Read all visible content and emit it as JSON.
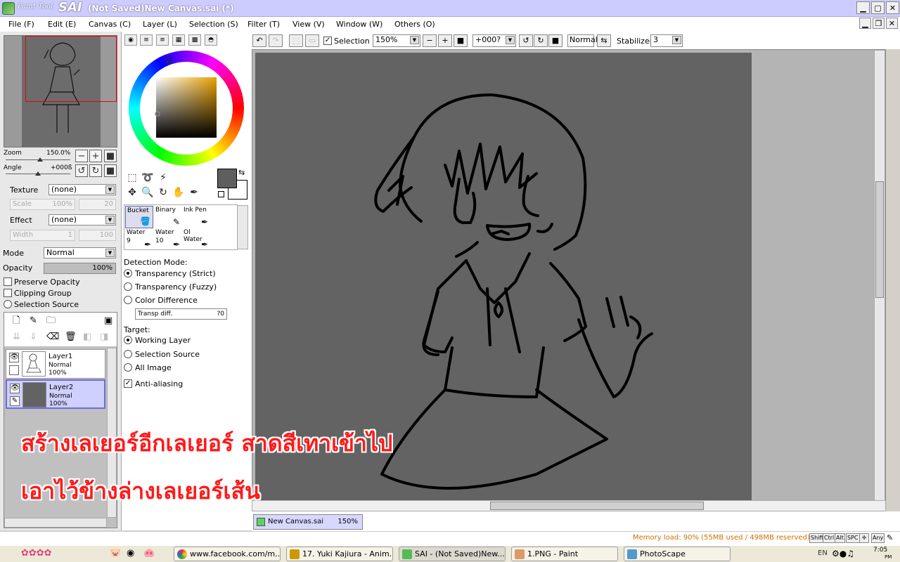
{
  "app": {
    "logo_small": "Paint Tool",
    "logo_big": "SAI",
    "window_title": "(Not Saved)New Canvas.sai (*)"
  },
  "menu": [
    "File (F)",
    "Edit (E)",
    "Canvas (C)",
    "Layer (L)",
    "Selection (S)",
    "Filter (T)",
    "View (V)",
    "Window (W)",
    "Others (O)"
  ],
  "navigator": {
    "zoom_label": "Zoom",
    "zoom_value": "150.0%",
    "angle_label": "Angle",
    "angle_value": "+000ß"
  },
  "texture": {
    "label": "Texture",
    "value": "(none)",
    "scale_label": "Scale",
    "scale_value": "100%",
    "scale_num": "20"
  },
  "effect": {
    "label": "Effect",
    "value": "(none)",
    "width_label": "Width",
    "width_value": "1",
    "width_num": "100"
  },
  "layer_props": {
    "mode_label": "Mode",
    "mode_value": "Normal",
    "opacity_label": "Opacity",
    "opacity_value": "100%",
    "opacity_level": 1.0,
    "preserve_opacity": "Preserve Opacity",
    "clipping_group": "Clipping Group",
    "selection_source": "Selection Source"
  },
  "layers": [
    {
      "name": "Layer1",
      "mode": "Normal",
      "opacity": "100%",
      "selected": false
    },
    {
      "name": "Layer2",
      "mode": "Normal",
      "opacity": "100%",
      "selected": true
    }
  ],
  "colors": {
    "foreground": "#5e5e5e",
    "background": "#ffffff",
    "canvas": "#636363",
    "overlay_text": "#ff1a1a"
  },
  "brushes": [
    {
      "name": "Bucket",
      "size": "",
      "selected": true
    },
    {
      "name": "Binary",
      "size": "",
      "selected": false
    },
    {
      "name": "Ink Pen",
      "size": "",
      "selected": false
    },
    {
      "name": "Water",
      "size": "9",
      "selected": false
    },
    {
      "name": "Water",
      "size": "10",
      "selected": false
    },
    {
      "name": "Ol Water",
      "size": "",
      "selected": false
    }
  ],
  "bucket": {
    "detection_mode_label": "Detection Mode:",
    "modes": [
      "Transparency (Strict)",
      "Transparency (Fuzzy)",
      "Color Difference"
    ],
    "selected_mode": 0,
    "transp_diff_label": "Transp diff.",
    "transp_diff_value": "?0",
    "target_label": "Target:",
    "targets": [
      "Working Layer",
      "Selection Source",
      "All Image"
    ],
    "selected_target": 0,
    "antialias_label": "Anti-aliasing",
    "antialias_checked": true
  },
  "canvas_toolbar": {
    "selection_label": "Selection",
    "selection_checked": true,
    "zoom_value": "150%",
    "angle_value": "+000?",
    "blend_mode": "Normal",
    "stabilizer_label": "Stabilizer",
    "stabilizer_value": "3"
  },
  "overlay": {
    "line1": "สร้างเลเยอร์อีกเลเยอร์ สาดสีเทาเข้าไป",
    "line2": "เอาไว้ข้างล่างเลเยอร์เส้น"
  },
  "canvas_tab": {
    "name": "New Canvas.sai",
    "zoom": "150%"
  },
  "status": {
    "memory": "Memory load: 90% (55MB used / 498MB reserved)",
    "keys": [
      "Shift",
      "Ctrl",
      "Alt",
      "SPC",
      "Any"
    ]
  },
  "taskbar": {
    "apps": [
      "www.facebook.com/m...",
      "17. Yuki Kajiura - Anim...",
      "SAI - (Not Saved)New...",
      "1.PNG - Paint",
      "PhotoScape"
    ],
    "lang": "EN",
    "time": "7:05",
    "ampm": "PM"
  }
}
